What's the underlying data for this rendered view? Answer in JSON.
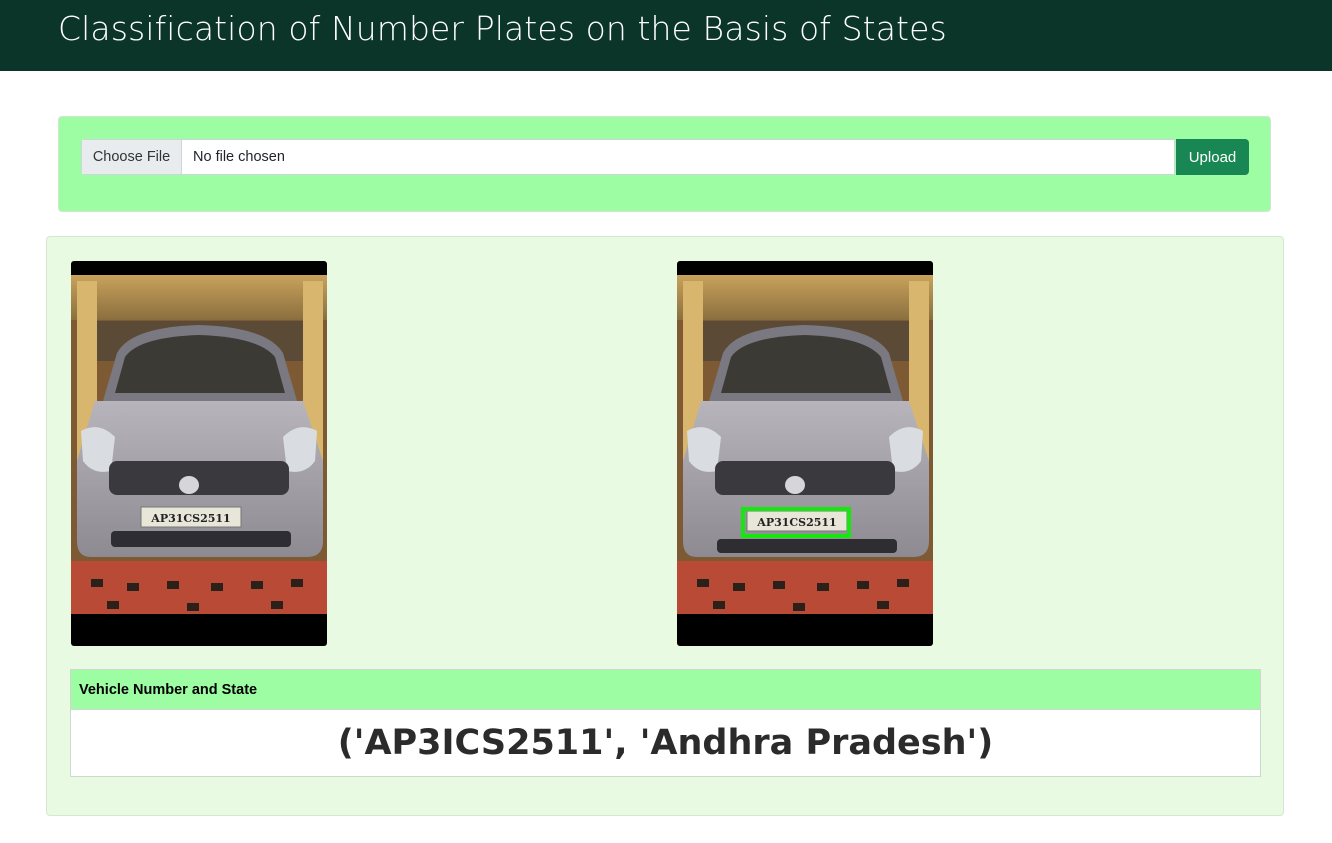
{
  "header": {
    "title": "Classification of Number Plates on the Basis of States"
  },
  "upload": {
    "choose_file_label": "Choose File",
    "file_status": "No file chosen",
    "upload_label": "Upload"
  },
  "images": {
    "original": {
      "plate_text": "AP31CS2511"
    },
    "detected": {
      "plate_text": "AP31CS2511",
      "highlight_color": "#16e80f"
    }
  },
  "result": {
    "header": "Vehicle Number and State",
    "value": "('AP3ICS2511', 'Andhra Pradesh')"
  },
  "colors": {
    "navbar": "#0a3528",
    "upload_panel": "#9dfda2",
    "result_panel": "#e9fae3",
    "upload_button": "#198754"
  }
}
